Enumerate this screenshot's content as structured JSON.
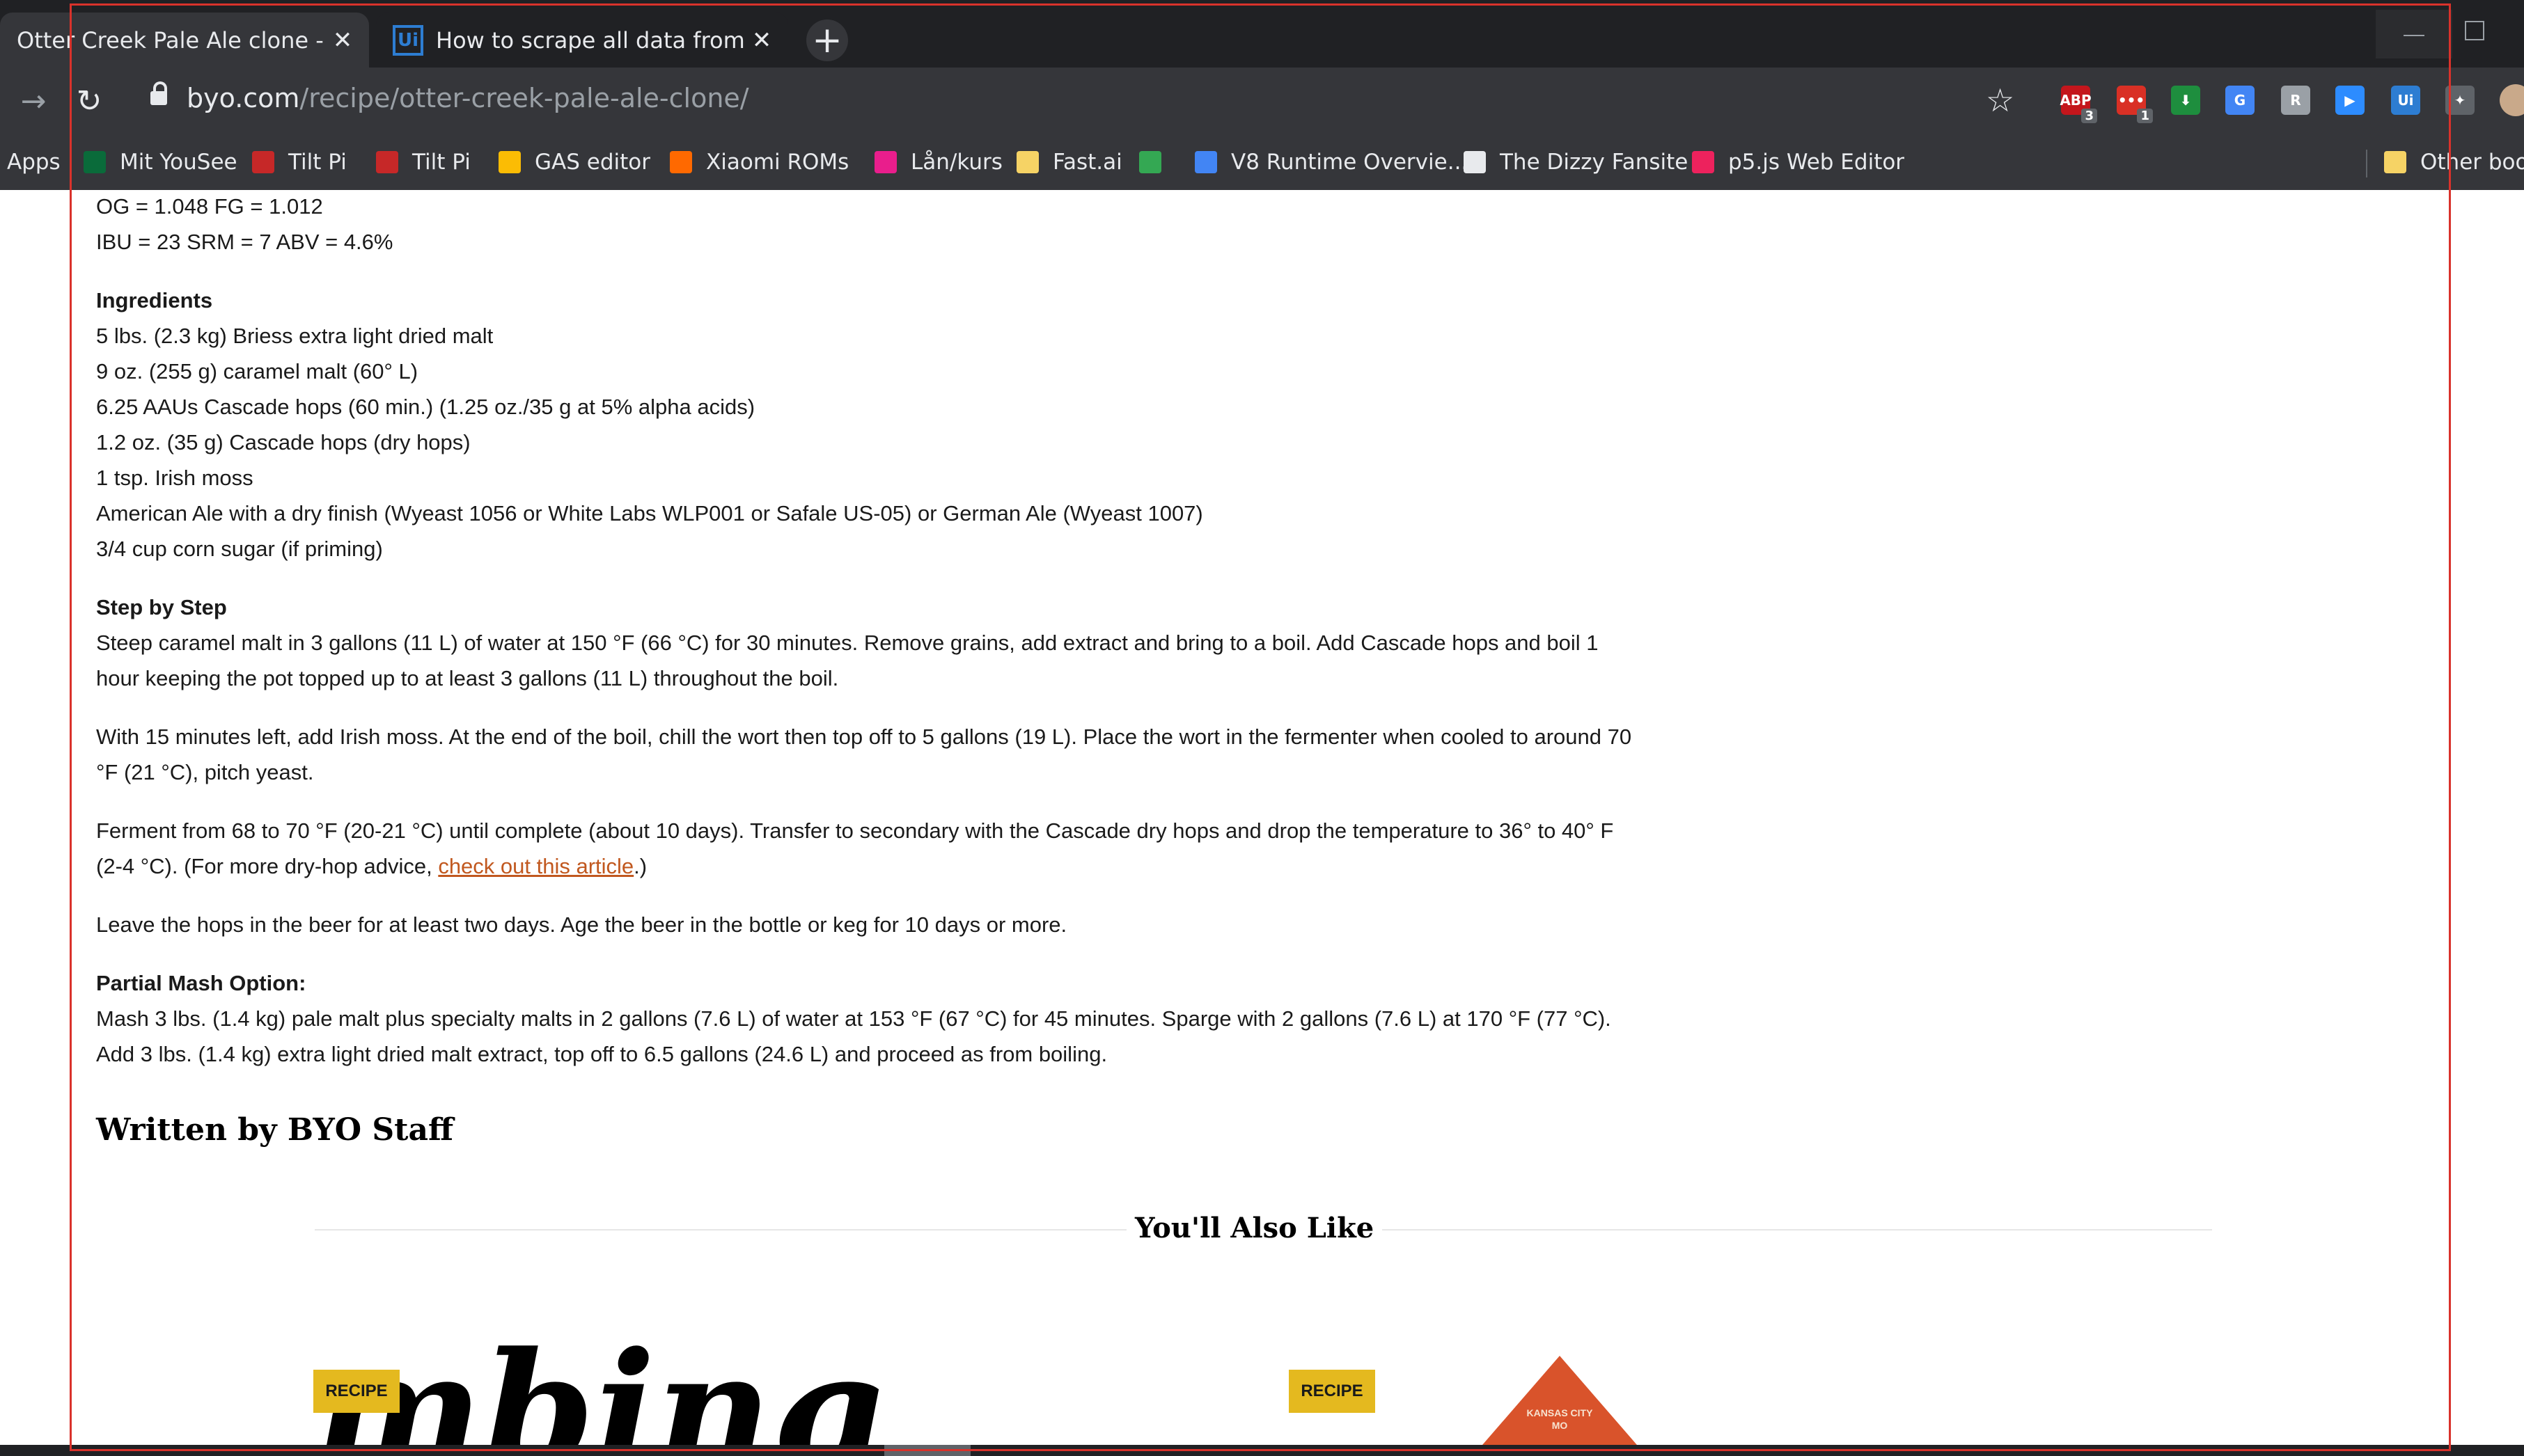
{
  "tabs": [
    {
      "title": "Otter Creek Pale Ale clone - Brew",
      "active": true
    },
    {
      "title": "How to scrape all data from a we",
      "active": false,
      "icon": "Ui"
    }
  ],
  "toolbar": {
    "url_host": "byo.com",
    "url_path": "/recipe/otter-creek-pale-ale-clone/",
    "extensions": [
      {
        "name": "abp-icon",
        "label": "ABP",
        "count": "3",
        "color": "#c4161c"
      },
      {
        "name": "todo-icon",
        "label": "•••",
        "count": "1",
        "color": "#d93025"
      },
      {
        "name": "download-arrow-icon",
        "label": "⬇",
        "count": "",
        "color": "#1e8e3e"
      },
      {
        "name": "translate-icon",
        "label": "G",
        "count": "",
        "color": "#4285f4"
      },
      {
        "name": "r-icon",
        "label": "R",
        "count": "",
        "color": "#9aa0a6"
      },
      {
        "name": "zoom-icon",
        "label": "▶",
        "count": "",
        "color": "#2d8cff"
      },
      {
        "name": "uipath-icon",
        "label": "Ui",
        "count": "",
        "color": "#2d7dd2"
      },
      {
        "name": "puzzle-icon",
        "label": "✦",
        "count": "",
        "color": "#5f6368"
      }
    ]
  },
  "bookmarks": [
    {
      "name": "bookmark-apps",
      "label": "Apps",
      "color": ""
    },
    {
      "name": "bookmark-mit-yousee",
      "label": "Mit YouSee",
      "color": "#0a6b3a"
    },
    {
      "name": "bookmark-tilt-pi-1",
      "label": "Tilt Pi",
      "color": "#c62828"
    },
    {
      "name": "bookmark-tilt-pi-2",
      "label": "Tilt Pi",
      "color": "#c62828"
    },
    {
      "name": "bookmark-gas-editor",
      "label": "GAS editor",
      "color": "#fbbc04"
    },
    {
      "name": "bookmark-xiaomi-roms",
      "label": "Xiaomi ROMs",
      "color": "#ff6900"
    },
    {
      "name": "bookmark-lan-kurs",
      "label": "Lån/kurs",
      "color": "#e91e8c"
    },
    {
      "name": "bookmark-fast-ai",
      "label": "Fast.ai",
      "color": "#f6d365"
    },
    {
      "name": "bookmark-drive",
      "label": "",
      "color": "#34a853"
    },
    {
      "name": "bookmark-v8-runtime",
      "label": "V8 Runtime Overvie...",
      "color": "#4285f4"
    },
    {
      "name": "bookmark-dizzy-fansite",
      "label": "The Dizzy Fansite",
      "color": "#e8eaed"
    },
    {
      "name": "bookmark-p5js",
      "label": "p5.js Web Editor",
      "color": "#ed225d"
    },
    {
      "name": "bookmark-other",
      "label": "Other boo",
      "color": "#f6d365"
    }
  ],
  "article": {
    "stats_line1": "OG = 1.048  FG = 1.012",
    "stats_line2": "IBU = 23  SRM = 7  ABV = 4.6%",
    "ingredients_heading": "Ingredients",
    "ingredients": [
      "5 lbs. (2.3 kg) Briess extra light dried malt",
      "9 oz. (255 g) caramel malt (60° L)",
      "6.25 AAUs Cascade hops (60 min.) (1.25 oz./35 g at 5% alpha acids)",
      "1.2 oz. (35 g) Cascade hops (dry hops)",
      "1 tsp. Irish moss",
      "American Ale with a dry finish (Wyeast 1056 or White Labs WLP001 or Safale US-05) or German Ale (Wyeast 1007)",
      "3/4 cup corn sugar (if priming)"
    ],
    "step_heading": "Step by Step",
    "step1": "Steep caramel malt in 3 gallons (11 L) of water at 150 °F (66 °C) for 30 minutes. Remove grains, add extract and bring to a boil. Add Cascade hops and boil 1 hour keeping the pot topped up to at least 3 gallons (11 L) throughout the boil.",
    "step2": "With 15 minutes left, add Irish moss. At the end of the boil, chill the wort then top off to 5 gallons (19 L). Place the wort in the fermenter when cooled to around 70 °F (21 °C), pitch yeast.",
    "step3_before": "Ferment from 68 to 70 °F (20-21 °C) until complete (about 10 days). Transfer to secondary with the Cascade dry hops and drop the temperature to 36° to 40° F (2-4 °C). (For more dry-hop advice, ",
    "step3_link": "check out this article",
    "step3_after": ".)",
    "step4": "Leave the hops in the beer for at least two days. Age the beer in the bottle or keg for 10 days or more.",
    "partial_heading": "Partial Mash Option:",
    "partial": "Mash 3 lbs. (1.4 kg) pale malt plus specialty malts in 2 gallons (7.6 L) of water at 153 °F (67 °C) for 45 minutes. Sparge with 2 gallons (7.6 L) at 170 °F (77 °C).  Add 3 lbs. (1.4 kg) extra light dried malt extract, top off to 6.5 gallons (24.6 L) and proceed as from boiling."
  },
  "written_by": "Written by BYO Staff",
  "also_like": {
    "title": "You'll Also Like",
    "card1_badge": "RECIPE",
    "card1_image_text": "mbing",
    "card2_badge": "RECIPE",
    "card2_image_text": "KANSAS CITY MO"
  }
}
